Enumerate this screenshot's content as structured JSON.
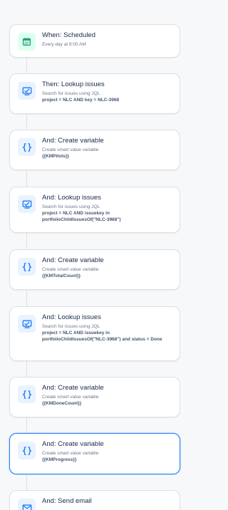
{
  "rule_steps": [
    {
      "kind": "trigger",
      "title": "When: Scheduled",
      "subtitle": "Every day at 9:00 AM",
      "detail": "",
      "icon": "calendar-icon",
      "selected": false
    },
    {
      "kind": "lookup",
      "title": "Then: Lookup issues",
      "subtitle": "Search for issues using JQL",
      "detail": "project = NLC AND key = NLC-3968",
      "icon": "lookup-issues-icon",
      "selected": false
    },
    {
      "kind": "variable",
      "title": "And: Create variable",
      "subtitle": "Create smart value variable",
      "detail": "{{KMPilots}}",
      "icon": "braces-icon",
      "selected": false
    },
    {
      "kind": "lookup",
      "title": "And: Lookup issues",
      "subtitle": "Search for issues using JQL",
      "detail": "project = NLC AND issuekey in portfolioChildIssuesOf(\"NLC-3968\")",
      "icon": "lookup-issues-icon",
      "selected": false
    },
    {
      "kind": "variable",
      "title": "And: Create variable",
      "subtitle": "Create smart value variable",
      "detail": "{{KMTotalCount}}",
      "icon": "braces-icon",
      "selected": false
    },
    {
      "kind": "lookup",
      "title": "And: Lookup issues",
      "subtitle": "Search for issues using JQL",
      "detail": "project = NLC AND issuekey in portfolioChildIssuesOf(\"NLC-3968\") and status = Done",
      "icon": "lookup-issues-icon",
      "selected": false
    },
    {
      "kind": "variable",
      "title": "And: Create variable",
      "subtitle": "Create smart value variable",
      "detail": "{{KMDoneCount}}",
      "icon": "braces-icon",
      "selected": false
    },
    {
      "kind": "variable",
      "title": "And: Create variable",
      "subtitle": "Create smart value variable",
      "detail": "{{KMProgress}}",
      "icon": "braces-icon",
      "selected": true
    },
    {
      "kind": "email",
      "title": "And: Send email",
      "subtitle": "",
      "detail": "",
      "icon": "email-icon",
      "selected": false
    }
  ],
  "colors": {
    "trigger_icon": "#22a06b",
    "action_icon": "#1d7afc",
    "selected_border": "#2684ff"
  }
}
